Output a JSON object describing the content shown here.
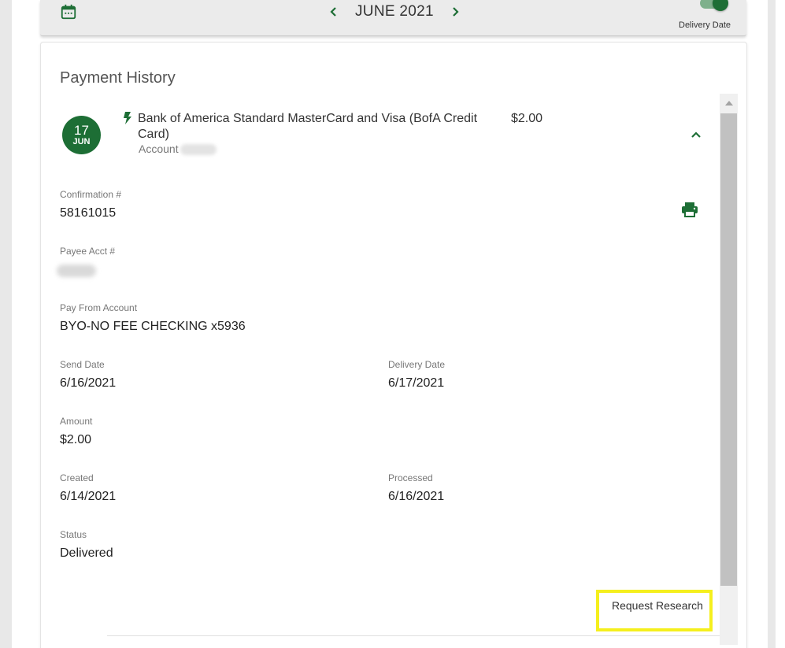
{
  "header": {
    "month_label": "JUNE 2021",
    "toggle_label": "Delivery Date",
    "toggle_on": true
  },
  "card": {
    "title": "Payment History"
  },
  "payment": {
    "day": "17",
    "month": "JUN",
    "payee": "Bank of America Standard MasterCard and Visa (BofA Credit Card)",
    "account_label": "Account",
    "amount": "$2.00"
  },
  "details": {
    "confirmation_label": "Confirmation #",
    "confirmation_value": "58161015",
    "payee_acct_label": "Payee Acct #",
    "pay_from_label": "Pay From Account",
    "pay_from_value": "BYO-NO FEE CHECKING x5936",
    "send_date_label": "Send Date",
    "send_date_value": "6/16/2021",
    "delivery_date_label": "Delivery Date",
    "delivery_date_value": "6/17/2021",
    "amount_label": "Amount",
    "amount_value": "$2.00",
    "created_label": "Created",
    "created_value": "6/14/2021",
    "processed_label": "Processed",
    "processed_value": "6/16/2021",
    "status_label": "Status",
    "status_value": "Delivered"
  },
  "actions": {
    "request_research": "Request Research"
  },
  "colors": {
    "brand_green": "#1d6e35",
    "highlight": "#f5ef1d"
  }
}
